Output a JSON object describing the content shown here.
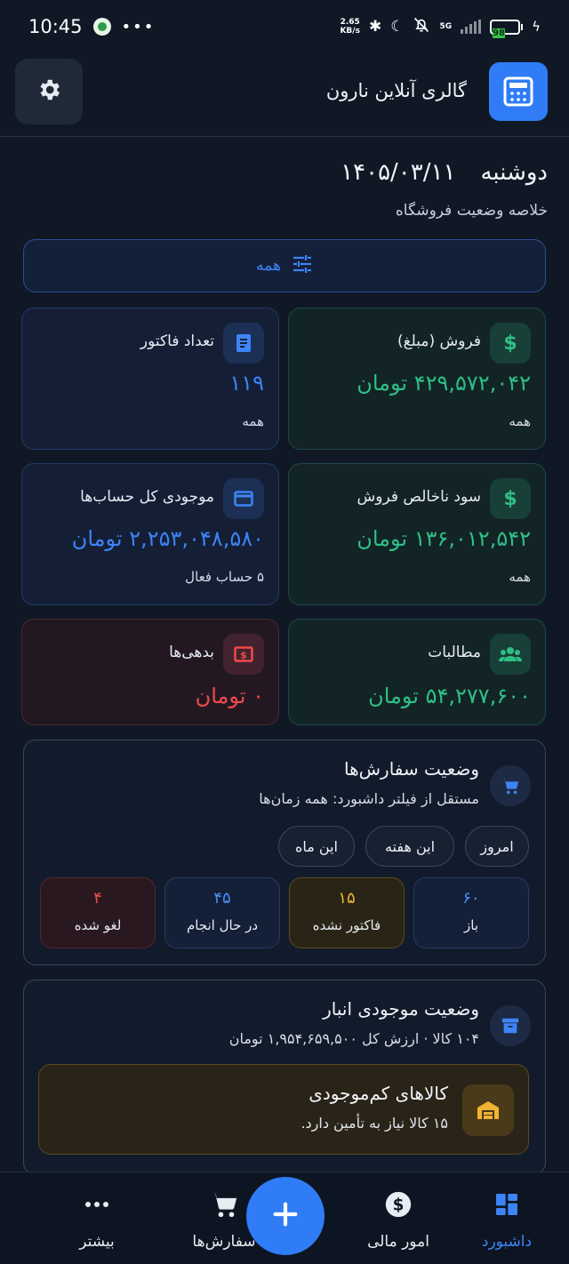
{
  "status_bar": {
    "time": "10:45",
    "speed": "2.65",
    "speed_unit": "KB/s",
    "network": "5G",
    "battery": "98"
  },
  "header": {
    "title": "گالری آنلاین نارون",
    "logo_icon": "register-icon",
    "settings_icon": "gear-icon"
  },
  "summary": {
    "weekday": "دوشنبه",
    "date": "۱۴۰۵/۰۳/۱۱",
    "subtitle": "خلاصه وضعیت فروشگاه"
  },
  "filter": {
    "label": "همه",
    "icon": "tune-icon"
  },
  "stats": {
    "sales": {
      "title": "فروش (مبلغ)",
      "value": "۴۲۹,۵۷۲,۰۴۲ تومان",
      "caption": "همه",
      "icon": "dollar-icon"
    },
    "invoices": {
      "title": "تعداد فاکتور",
      "value": "۱۱۹",
      "caption": "همه",
      "icon": "receipt-icon"
    },
    "gross_profit": {
      "title": "سود ناخالص فروش",
      "value": "۱۳۶,۰۱۲,۵۴۲ تومان",
      "caption": "همه",
      "icon": "dollar-icon"
    },
    "accounts": {
      "title": "موجودی کل حساب‌ها",
      "value": "۲,۲۵۳,۰۴۸,۵۸۰ تومان",
      "caption": "۵ حساب فعال",
      "icon": "card-icon"
    },
    "receivables": {
      "title": "مطالبات",
      "value": "۵۴,۲۷۷,۶۰۰ تومان",
      "icon": "people-icon"
    },
    "debts": {
      "title": "بدهی‌ها",
      "value": "۰ تومان",
      "icon": "bill-icon"
    }
  },
  "orders": {
    "title": "وضعیت سفارش‌ها",
    "subtitle": "مستقل از فیلتر داشبورد: همه زمان‌ها",
    "icon": "cart-icon",
    "chips": [
      "امروز",
      "این هفته",
      "این ماه"
    ],
    "statuses": [
      {
        "count": "۶۰",
        "label": "باز"
      },
      {
        "count": "۱۵",
        "label": "فاکتور نشده"
      },
      {
        "count": "۴۵",
        "label": "در حال انجام"
      },
      {
        "count": "۴",
        "label": "لغو شده"
      }
    ]
  },
  "inventory": {
    "title": "وضعیت موجودی انبار",
    "subtitle": "۱۰۴ کالا · ارزش کل ۱,۹۵۴,۶۵۹,۵۰۰ تومان",
    "icon": "archive-icon",
    "low_stock": {
      "title": "کالاهای کم‌موجودی",
      "subtitle": "۱۵ کالا نیاز به تأمین دارد.",
      "icon": "warehouse-icon"
    }
  },
  "bottom_nav": {
    "dashboard": "داشبورد",
    "finance": "امور مالی",
    "orders": "سفارش‌ها",
    "more": "بیشتر"
  },
  "colors": {
    "accent": "#2f7cf6",
    "green": "#2fbf86",
    "red": "#ef4a4a",
    "amber": "#f0b432",
    "background": "#101826"
  }
}
